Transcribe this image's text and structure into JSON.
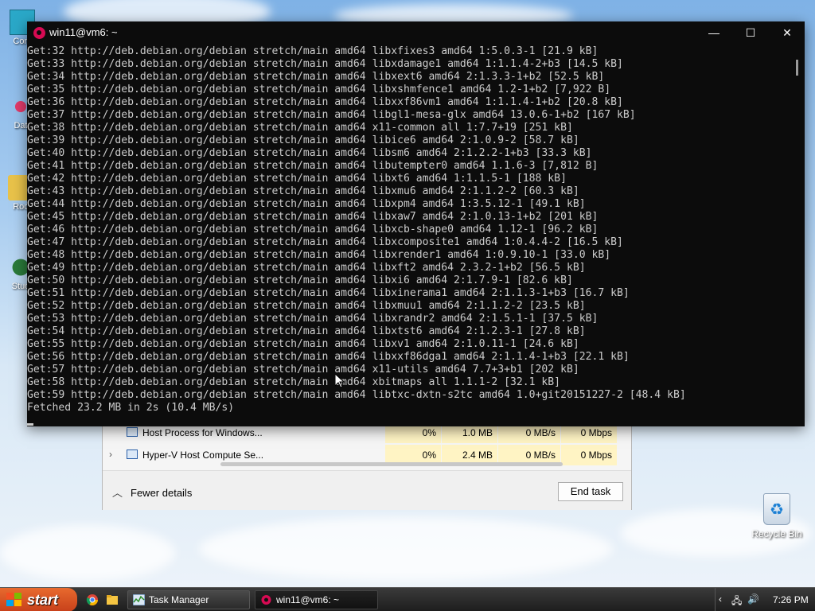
{
  "terminal": {
    "title": "win11@vm6: ~",
    "lines": [
      "Get:32 http://deb.debian.org/debian stretch/main amd64 libxfixes3 amd64 1:5.0.3-1 [21.9 kB]",
      "Get:33 http://deb.debian.org/debian stretch/main amd64 libxdamage1 amd64 1:1.1.4-2+b3 [14.5 kB]",
      "Get:34 http://deb.debian.org/debian stretch/main amd64 libxext6 amd64 2:1.3.3-1+b2 [52.5 kB]",
      "Get:35 http://deb.debian.org/debian stretch/main amd64 libxshmfence1 amd64 1.2-1+b2 [7,922 B]",
      "Get:36 http://deb.debian.org/debian stretch/main amd64 libxxf86vm1 amd64 1:1.1.4-1+b2 [20.8 kB]",
      "Get:37 http://deb.debian.org/debian stretch/main amd64 libgl1-mesa-glx amd64 13.0.6-1+b2 [167 kB]",
      "Get:38 http://deb.debian.org/debian stretch/main amd64 x11-common all 1:7.7+19 [251 kB]",
      "Get:39 http://deb.debian.org/debian stretch/main amd64 libice6 amd64 2:1.0.9-2 [58.7 kB]",
      "Get:40 http://deb.debian.org/debian stretch/main amd64 libsm6 amd64 2:1.2.2-1+b3 [33.3 kB]",
      "Get:41 http://deb.debian.org/debian stretch/main amd64 libutempter0 amd64 1.1.6-3 [7,812 B]",
      "Get:42 http://deb.debian.org/debian stretch/main amd64 libxt6 amd64 1:1.1.5-1 [188 kB]",
      "Get:43 http://deb.debian.org/debian stretch/main amd64 libxmu6 amd64 2:1.1.2-2 [60.3 kB]",
      "Get:44 http://deb.debian.org/debian stretch/main amd64 libxpm4 amd64 1:3.5.12-1 [49.1 kB]",
      "Get:45 http://deb.debian.org/debian stretch/main amd64 libxaw7 amd64 2:1.0.13-1+b2 [201 kB]",
      "Get:46 http://deb.debian.org/debian stretch/main amd64 libxcb-shape0 amd64 1.12-1 [96.2 kB]",
      "Get:47 http://deb.debian.org/debian stretch/main amd64 libxcomposite1 amd64 1:0.4.4-2 [16.5 kB]",
      "Get:48 http://deb.debian.org/debian stretch/main amd64 libxrender1 amd64 1:0.9.10-1 [33.0 kB]",
      "Get:49 http://deb.debian.org/debian stretch/main amd64 libxft2 amd64 2.3.2-1+b2 [56.5 kB]",
      "Get:50 http://deb.debian.org/debian stretch/main amd64 libxi6 amd64 2:1.7.9-1 [82.6 kB]",
      "Get:51 http://deb.debian.org/debian stretch/main amd64 libxinerama1 amd64 2:1.1.3-1+b3 [16.7 kB]",
      "Get:52 http://deb.debian.org/debian stretch/main amd64 libxmuu1 amd64 2:1.1.2-2 [23.5 kB]",
      "Get:53 http://deb.debian.org/debian stretch/main amd64 libxrandr2 amd64 2:1.5.1-1 [37.5 kB]",
      "Get:54 http://deb.debian.org/debian stretch/main amd64 libxtst6 amd64 2:1.2.3-1 [27.8 kB]",
      "Get:55 http://deb.debian.org/debian stretch/main amd64 libxv1 amd64 2:1.0.11-1 [24.6 kB]",
      "Get:56 http://deb.debian.org/debian stretch/main amd64 libxxf86dga1 amd64 2:1.1.4-1+b3 [22.1 kB]",
      "Get:57 http://deb.debian.org/debian stretch/main amd64 x11-utils amd64 7.7+3+b1 [202 kB]",
      "Get:58 http://deb.debian.org/debian stretch/main amd64 xbitmaps all 1.1.1-2 [32.1 kB]",
      "Get:59 http://deb.debian.org/debian stretch/main amd64 libtxc-dxtn-s2tc amd64 1.0+git20151227-2 [48.4 kB]",
      "Fetched 23.2 MB in 2s (10.4 MB/s)"
    ],
    "minimize_icon": "minimize-icon",
    "maximize_icon": "maximize-icon",
    "close_icon": "close-icon"
  },
  "task_manager": {
    "rows": [
      {
        "name": "Host Process for Windows...",
        "cpu": "0%",
        "memory": "1.0 MB",
        "disk": "0 MB/s",
        "network": "0 Mbps"
      },
      {
        "name": "Hyper-V Host Compute Se...",
        "cpu": "0%",
        "memory": "2.4 MB",
        "disk": "0 MB/s",
        "network": "0 Mbps"
      }
    ],
    "fewer_details": "Fewer details",
    "end_task": "End task"
  },
  "desktop": {
    "recycle_bin": "Recycle Bin",
    "partial_icons": [
      "Com",
      "Dat",
      "Roc",
      "Stud"
    ]
  },
  "taskbar": {
    "start_label": "start",
    "buttons": [
      {
        "label": "Task Manager",
        "icon": "task-manager-icon"
      },
      {
        "label": "win11@vm6: ~",
        "icon": "debian-icon"
      }
    ],
    "clock": "7:26 PM"
  },
  "colors": {
    "terminal_bg": "#0c0c0c",
    "terminal_text": "#cccccc",
    "start_orange": "#d9531e"
  }
}
